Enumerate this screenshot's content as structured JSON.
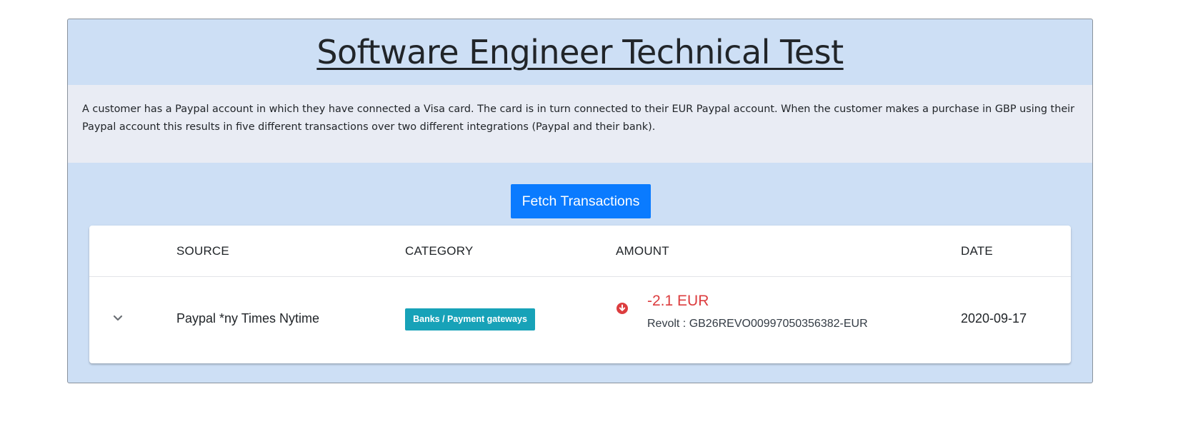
{
  "header": {
    "title": "Software Engineer Technical Test"
  },
  "description": "A customer has a Paypal account in which they have connected a Visa card. The card is in turn connected to their EUR Paypal account. When the customer makes a purchase in GBP using their Paypal account this results in five different transactions over two different integrations (Paypal and their bank).",
  "actions": {
    "fetch_label": "Fetch Transactions"
  },
  "table": {
    "columns": [
      "",
      "SOURCE",
      "CATEGORY",
      "AMOUNT",
      "DATE"
    ],
    "rows": [
      {
        "source": "Paypal *ny Times Nytime",
        "category": "Banks / Payment gateways",
        "amount": "-2.1 EUR",
        "account": "Revolt : GB26REVO00997050356382-EUR",
        "date": "2020-09-17",
        "direction_icon": "arrow-down-circle-icon"
      }
    ]
  },
  "colors": {
    "panel_bg": "#cddff5",
    "description_bg": "#e9ecf4",
    "button_bg": "#0a7bff",
    "badge_bg": "#17a2b8",
    "negative_amount": "#dc3d3f"
  }
}
